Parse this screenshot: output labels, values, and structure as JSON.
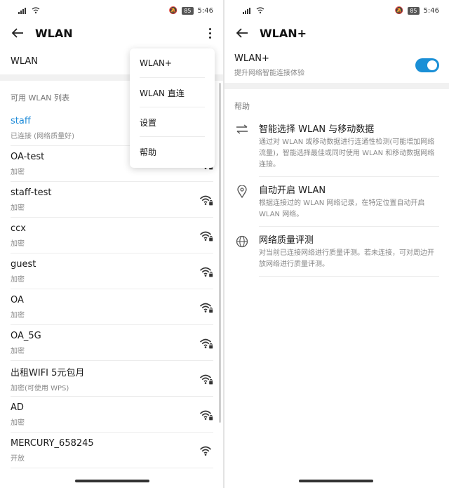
{
  "status": {
    "time": "5:46",
    "battery": "85",
    "signal": "4G"
  },
  "left": {
    "title": "WLAN",
    "wlan_toggle_label": "WLAN",
    "section_label": "可用 WLAN 列表",
    "networks": [
      {
        "name": "staff",
        "sub": "已连接 (网络质量好)",
        "active": true,
        "secured": true
      },
      {
        "name": "OA-test",
        "sub": "加密",
        "active": false,
        "secured": true
      },
      {
        "name": "staff-test",
        "sub": "加密",
        "active": false,
        "secured": true
      },
      {
        "name": "ccx",
        "sub": "加密",
        "active": false,
        "secured": true
      },
      {
        "name": "guest",
        "sub": "加密",
        "active": false,
        "secured": true
      },
      {
        "name": "OA",
        "sub": "加密",
        "active": false,
        "secured": true
      },
      {
        "name": "OA_5G",
        "sub": "加密",
        "active": false,
        "secured": true
      },
      {
        "name": "出租WIFI 5元包月",
        "sub": "加密(可使用 WPS)",
        "active": false,
        "secured": true
      },
      {
        "name": "AD",
        "sub": "加密",
        "active": false,
        "secured": true
      },
      {
        "name": "MERCURY_658245",
        "sub": "开放",
        "active": false,
        "secured": false
      }
    ],
    "menu": [
      "WLAN+",
      "WLAN 直连",
      "设置",
      "帮助"
    ]
  },
  "right": {
    "title": "WLAN+",
    "feature_title": "WLAN+",
    "feature_sub": "提升网络智能连接体验",
    "toggle_on": true,
    "help_label": "帮助",
    "help_items": [
      {
        "icon": "swap-arrows-icon",
        "title": "智能选择 WLAN 与移动数据",
        "desc": "通过对 WLAN 或移动数据进行连通性检测(可能增加网络流量)，智能选择最佳或同时使用 WLAN 和移动数据网络连接。"
      },
      {
        "icon": "location-pin-icon",
        "title": "自动开启 WLAN",
        "desc": "根据连接过的 WLAN 网络记录，在特定位置自动开启 WLAN 网络。"
      },
      {
        "icon": "globe-icon",
        "title": "网络质量评测",
        "desc": "对当前已连接网络进行质量评测。若未连接，可对周边开放网络进行质量评测。"
      }
    ]
  },
  "colors": {
    "accent": "#1f8bd8",
    "toggle": "#1a8fd6"
  }
}
